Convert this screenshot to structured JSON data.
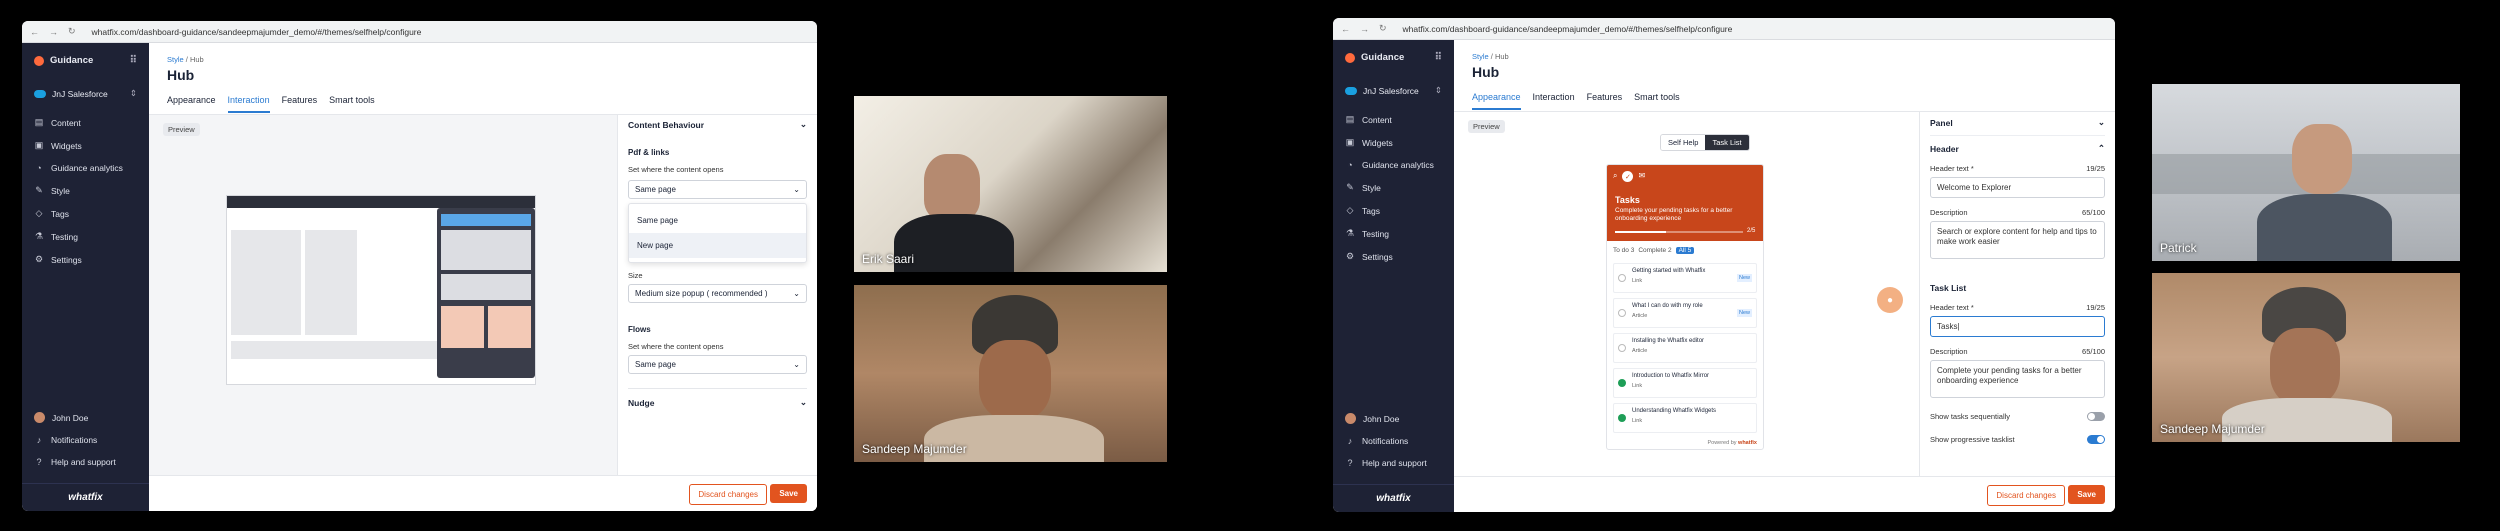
{
  "left_window": {
    "url": "whatfix.com/dashboard-guidance/sandeepmajumder_demo/#/themes/selfhelp/configure",
    "sidebar": {
      "brand": "Guidance",
      "account": "JnJ Salesforce",
      "items": [
        "Content",
        "Widgets",
        "Guidance analytics",
        "Style",
        "Tags",
        "Testing",
        "Settings"
      ],
      "icons": [
        "content-icon",
        "widgets-icon",
        "analytics-icon",
        "style-icon",
        "tag-icon",
        "testing-icon",
        "gear-icon"
      ],
      "user": "John Doe",
      "notifications": "Notifications",
      "help": "Help and support",
      "logo": "whatfix"
    },
    "breadcrumb": {
      "parent": "Style",
      "sep": "/",
      "current": "Hub"
    },
    "title": "Hub",
    "tabs": [
      "Appearance",
      "Interaction",
      "Features",
      "Smart tools"
    ],
    "active_tab": "Interaction",
    "preview_label": "Preview",
    "panel": {
      "content_behaviour": "Content Behaviour",
      "pdf_links": "Pdf & links",
      "set_where": "Set where the content opens",
      "selected": "Same page",
      "options": [
        "Same page",
        "New page"
      ],
      "size_label": "Size",
      "size_value": "Medium size popup ( recommended )",
      "flows": "Flows",
      "flows_set_where": "Set where the content opens",
      "flows_value": "Same page",
      "nudge": "Nudge"
    },
    "footer": {
      "discard": "Discard changes",
      "save": "Save"
    }
  },
  "videos": {
    "p1": "Erik Saari",
    "p2": "Sandeep Majumder",
    "p3": "Patrick",
    "p4": "Sandeep Majumder"
  },
  "right_window": {
    "url": "whatfix.com/dashboard-guidance/sandeepmajumder_demo/#/themes/selfhelp/configure",
    "breadcrumb": {
      "parent": "Style",
      "sep": "/",
      "current": "Hub"
    },
    "title": "Hub",
    "tabs": [
      "Appearance",
      "Interaction",
      "Features",
      "Smart tools"
    ],
    "active_tab": "Appearance",
    "preview_label": "Preview",
    "toggle_options": [
      "Self Help",
      "Task List"
    ],
    "widget": {
      "title": "Tasks",
      "subtitle": "Complete your pending tasks for a better onboarding experience",
      "progress": "2/5",
      "filters": [
        "To do 3",
        "Complete 2",
        "All 5"
      ],
      "tasks": [
        {
          "title": "Getting started with Whatfix",
          "tag": "Link",
          "badge": "New"
        },
        {
          "title": "What I can do with my role",
          "tag": "Article",
          "badge": "New"
        },
        {
          "title": "Installing the Whatfix editor",
          "tag": "Article",
          "badge": ""
        },
        {
          "title": "Introduction to Whatfix Mirror",
          "tag": "Link",
          "badge": ""
        },
        {
          "title": "Understanding Whatfix Widgets",
          "tag": "Link",
          "badge": ""
        }
      ],
      "powered": "Powered by",
      "powered_brand": "whatfix"
    },
    "panel": {
      "panel_label": "Panel",
      "header_label": "Header",
      "header_text_label": "Header text *",
      "header_count": "19/25",
      "header_value": "Welcome to Explorer",
      "description_label": "Description",
      "description_count": "65/100",
      "description_value": "Search or explore content for help and tips to make work easier",
      "tasklist_label": "Task List",
      "tl_header_label": "Header text *",
      "tl_header_count": "19/25",
      "tl_header_value": "Tasks|",
      "tl_description_label": "Description",
      "tl_description_count": "65/100",
      "tl_description_value": "Complete your pending tasks for a better onboarding experience",
      "show_sequential": "Show tasks sequentially",
      "show_progressive": "Show progressive tasklist"
    },
    "footer": {
      "discard": "Discard changes",
      "save": "Save"
    }
  },
  "colors": {
    "accent": "#2b7bd1",
    "brand": "#e2541f",
    "sidebar": "#1e2235",
    "widget": "#c8461b"
  }
}
